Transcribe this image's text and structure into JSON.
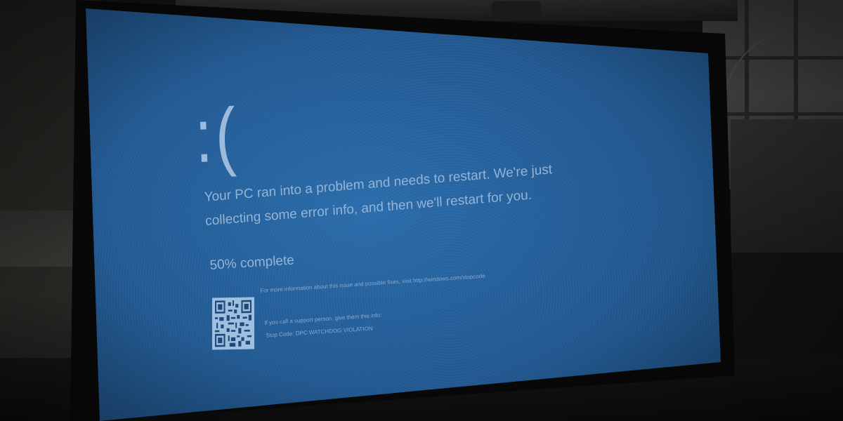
{
  "bsod": {
    "frown": ":(",
    "message": "Your PC ran into a problem and needs to restart. We're just collecting some error info, and then we'll restart for you.",
    "progress_text": "50% complete",
    "progress": 0.5,
    "info_line": "For more information about this issue and possible fixes, visit http://windows.com/stopcode",
    "support_line": "If you call a support person, give them this info:",
    "stop_code": "Stop Code: DPC WATCHDOG VIOLATION"
  },
  "colors": {
    "screen_blue": "#245d97",
    "text": "#93b5d8"
  },
  "icons": {
    "qr": "qr-code-icon"
  }
}
